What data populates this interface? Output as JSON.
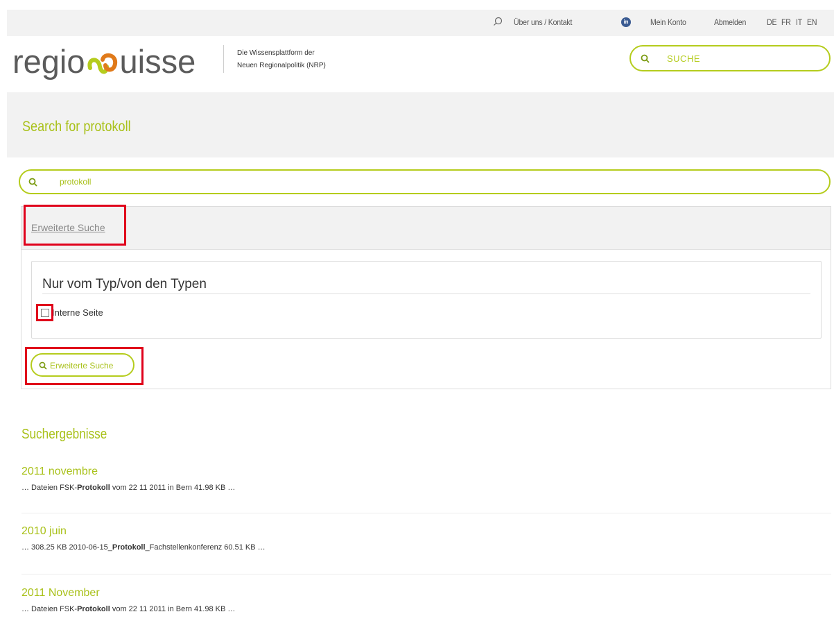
{
  "topbar": {
    "about_contact": "Über uns / Kontakt",
    "my_account": "Mein Konto",
    "logout": "Abmelden",
    "languages": [
      "DE",
      "FR",
      "IT",
      "EN"
    ]
  },
  "header": {
    "logo_left": "regio",
    "logo_right": "uisse",
    "tagline_line1": "Die Wissensplattform der",
    "tagline_line2": "Neuen Regionalpolitik (NRP)",
    "search_placeholder": "SUCHE"
  },
  "page": {
    "title": "Search for protokoll"
  },
  "search": {
    "value": "protokoll"
  },
  "advanced": {
    "toggle_label": "Erweiterte Suche",
    "type_heading": "Nur vom Typ/von den Typen",
    "checkbox_label": "Interne Seite",
    "button_label": "Erweiterte Suche"
  },
  "results": {
    "heading": "Suchergebnisse",
    "items": [
      {
        "title": "2011 novembre",
        "pre": "… Dateien FSK-",
        "bold": "Protokoll",
        "post": " vom 22 11 2011 in Bern 41.98 KB …"
      },
      {
        "title": "2010 juin",
        "pre": "… 308.25 KB 2010-06-15_",
        "bold": "Protokoll",
        "post": "_Fachstellenkonferenz 60.51 KB …"
      },
      {
        "title": "2011 November",
        "pre": "… Dateien FSK-",
        "bold": "Protokoll",
        "post": " vom 22 11 2011 in Bern 41.98 KB …"
      }
    ]
  },
  "colors": {
    "accent": "#b5cc1d",
    "highlight_box": "#e0001b",
    "band": "#f2f2f2"
  },
  "icons": [
    "search-icon",
    "linkedin-icon",
    "logo-mark-icon"
  ]
}
